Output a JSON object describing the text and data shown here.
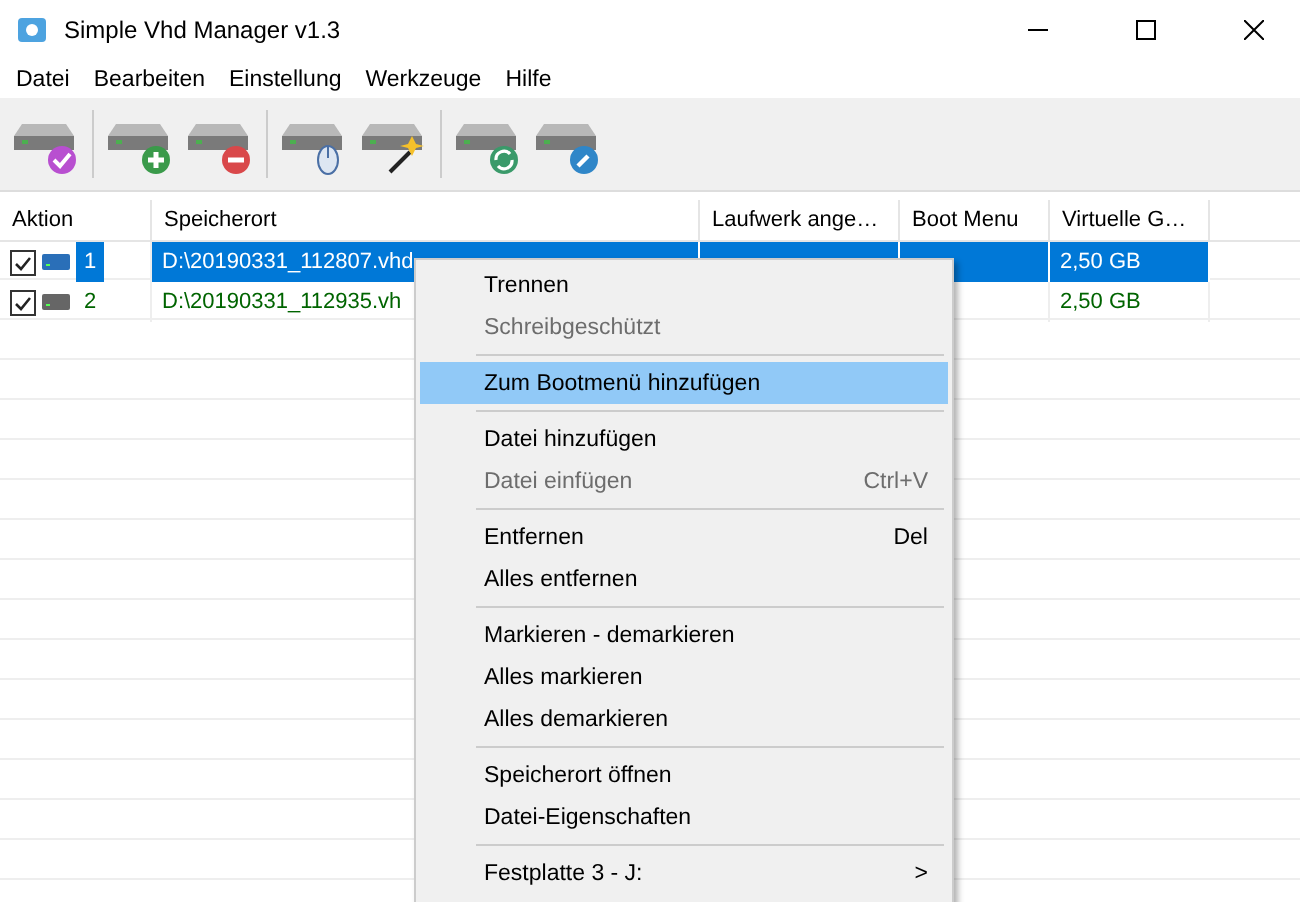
{
  "window": {
    "title": "Simple Vhd Manager v1.3"
  },
  "menu_bar": [
    "Datei",
    "Bearbeiten",
    "Einstellung",
    "Werkzeuge",
    "Hilfe"
  ],
  "table": {
    "columns": [
      "Aktion",
      "Speicherort",
      "Laufwerk ange…",
      "Boot Menu",
      "Virtuelle G…"
    ],
    "rows": [
      {
        "checked": true,
        "selected": true,
        "number": "1",
        "path": "D:\\20190331_112807.vhd",
        "size": "2,50 GB"
      },
      {
        "checked": true,
        "selected": false,
        "number": "2",
        "path": "D:\\20190331_112935.vh",
        "size": "2,50 GB"
      }
    ]
  },
  "context_menu": [
    {
      "kind": "item",
      "label": "Trennen",
      "disabled": false,
      "selected": false
    },
    {
      "kind": "item",
      "label": "Schreibgeschützt",
      "disabled": true,
      "selected": false
    },
    {
      "kind": "separator"
    },
    {
      "kind": "item",
      "label": "Zum Bootmenü hinzufügen",
      "disabled": false,
      "selected": true
    },
    {
      "kind": "separator"
    },
    {
      "kind": "item",
      "label": "Datei hinzufügen",
      "disabled": false,
      "selected": false
    },
    {
      "kind": "item",
      "label": "Datei einfügen",
      "shortcut": "Ctrl+V",
      "disabled": true,
      "selected": false
    },
    {
      "kind": "separator"
    },
    {
      "kind": "item",
      "label": "Entfernen",
      "shortcut": "Del",
      "disabled": false,
      "selected": false
    },
    {
      "kind": "item",
      "label": "Alles entfernen",
      "disabled": false,
      "selected": false
    },
    {
      "kind": "separator"
    },
    {
      "kind": "item",
      "label": "Markieren - demarkieren",
      "disabled": false,
      "selected": false
    },
    {
      "kind": "item",
      "label": "Alles markieren",
      "disabled": false,
      "selected": false
    },
    {
      "kind": "item",
      "label": "Alles demarkieren",
      "disabled": false,
      "selected": false
    },
    {
      "kind": "separator"
    },
    {
      "kind": "item",
      "label": "Speicherort öffnen",
      "disabled": false,
      "selected": false
    },
    {
      "kind": "item",
      "label": "Datei-Eigenschaften",
      "disabled": false,
      "selected": false
    },
    {
      "kind": "separator"
    },
    {
      "kind": "submenu",
      "label": "Festplatte 3  -  J:",
      "arrow": ">",
      "disabled": false,
      "selected": false
    }
  ]
}
